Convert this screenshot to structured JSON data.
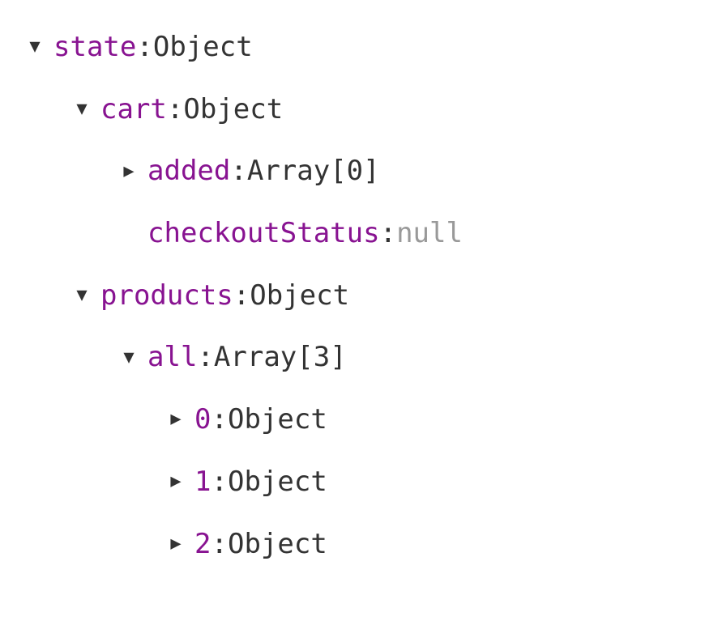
{
  "tree": [
    {
      "indent": 0,
      "arrow": "expanded",
      "key": "state",
      "value": "Object",
      "valueClass": "value-type"
    },
    {
      "indent": 1,
      "arrow": "expanded",
      "key": "cart",
      "value": "Object",
      "valueClass": "value-type"
    },
    {
      "indent": 2,
      "arrow": "collapsed",
      "key": "added",
      "value": "Array[0]",
      "valueClass": "value-type"
    },
    {
      "indent": 2,
      "arrow": "none",
      "key": "checkoutStatus",
      "value": "null",
      "valueClass": "value-null"
    },
    {
      "indent": 1,
      "arrow": "expanded",
      "key": "products",
      "value": "Object",
      "valueClass": "value-type"
    },
    {
      "indent": 2,
      "arrow": "expanded",
      "key": "all",
      "value": "Array[3]",
      "valueClass": "value-type"
    },
    {
      "indent": 3,
      "arrow": "collapsed",
      "key": "0",
      "value": "Object",
      "valueClass": "value-type"
    },
    {
      "indent": 3,
      "arrow": "collapsed",
      "key": "1",
      "value": "Object",
      "valueClass": "value-type"
    },
    {
      "indent": 3,
      "arrow": "collapsed",
      "key": "2",
      "value": "Object",
      "valueClass": "value-type"
    }
  ],
  "colon": ":"
}
